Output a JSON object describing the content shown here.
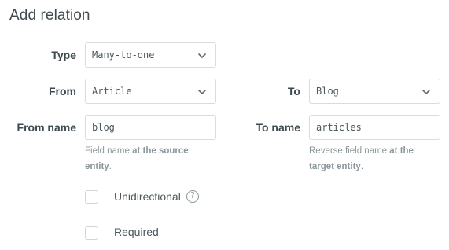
{
  "dialog": {
    "title": "Add relation"
  },
  "type": {
    "label": "Type",
    "value": "Many-to-one"
  },
  "from": {
    "label": "From",
    "value": "Article"
  },
  "to": {
    "label": "To",
    "value": "Blog"
  },
  "from_name": {
    "label": "From name",
    "value": "blog",
    "help_prefix": "Field name ",
    "help_bold": "at the source entity",
    "help_suffix": "."
  },
  "to_name": {
    "label": "To name",
    "value": "articles",
    "help_prefix": "Reverse field name ",
    "help_bold": "at the target entity",
    "help_suffix": "."
  },
  "options": {
    "unidirectional_label": "Unidirectional",
    "help_icon_glyph": "?",
    "required_label": "Required"
  },
  "icons": {
    "chevron": "chevron-down-icon",
    "help": "question-circle-icon"
  },
  "colors": {
    "text": "#3c4a4f",
    "muted": "#8c979b",
    "border": "#d7dcde"
  }
}
